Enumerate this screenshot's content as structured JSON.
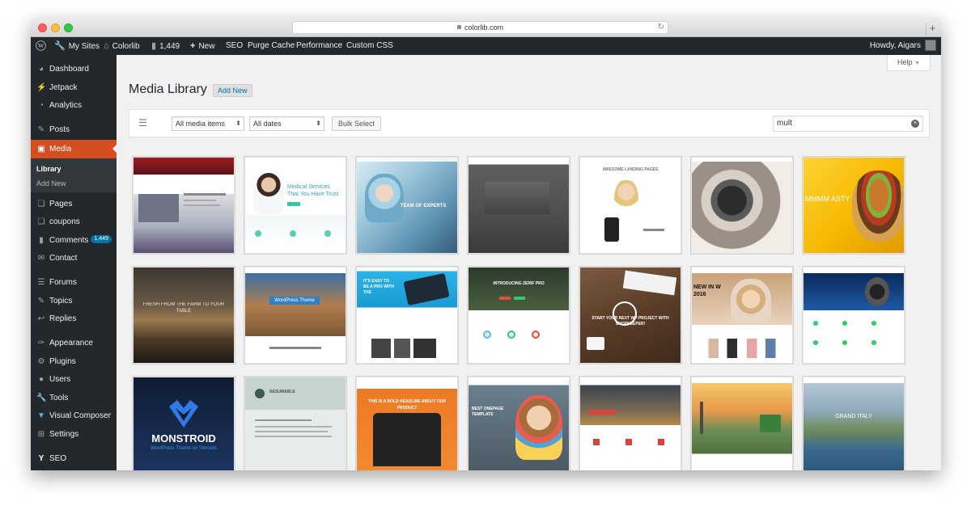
{
  "browser": {
    "url": "colorlib.com"
  },
  "adminbar": {
    "my_sites": "My Sites",
    "site_name": "Colorlib",
    "comments_count": "1,449",
    "new_label": "New",
    "seo": "SEO",
    "purge_cache": "Purge Cache",
    "performance": "Performance",
    "custom_css": "Custom CSS",
    "howdy": "Howdy, Aigars"
  },
  "sidebar": {
    "dashboard": "Dashboard",
    "jetpack": "Jetpack",
    "analytics": "Analytics",
    "posts": "Posts",
    "media": "Media",
    "library": "Library",
    "add_new": "Add New",
    "pages": "Pages",
    "coupons": "coupons",
    "comments": "Comments",
    "comments_badge": "1,449",
    "contact": "Contact",
    "forums": "Forums",
    "topics": "Topics",
    "replies": "Replies",
    "appearance": "Appearance",
    "plugins": "Plugins",
    "users": "Users",
    "tools": "Tools",
    "visual_composer": "Visual Composer",
    "settings": "Settings",
    "seo": "SEO"
  },
  "main": {
    "help": "Help",
    "title": "Media Library",
    "add_new": "Add New",
    "filter_type": "All media items",
    "filter_date": "All dates",
    "bulk_select": "Bulk Select",
    "search_value": "mult"
  },
  "tiles": [
    {
      "caption": ""
    },
    {
      "caption": "Medical Services That You Have Trust"
    },
    {
      "caption": "TEAM OF EXPERTS"
    },
    {
      "caption": ""
    },
    {
      "caption": "AWESOME LANDING PAGES"
    },
    {
      "caption": ""
    },
    {
      "caption": "MMMM ASTY"
    },
    {
      "caption": "FRESH FROM THE FARM TO YOUR TABLE"
    },
    {
      "caption": "WordPress Theme"
    },
    {
      "caption": "IT'S EASY TO BE A PRO WITH THE"
    },
    {
      "caption": "INTRODUCING ZERIF PRO"
    },
    {
      "caption": "START YOUR NEXT WP PROJECT WITH SHOPKEEPER!"
    },
    {
      "caption": "NEW IN W 2016"
    },
    {
      "caption": ""
    },
    {
      "caption": "MONSTROID",
      "sub": "WordPress Theme on Steroids"
    },
    {
      "caption": "RESUMABLE"
    },
    {
      "caption": "THIS IS A BOLD HEADLINE ABOUT OUR PRODUCT"
    },
    {
      "caption": "BEST ONEPAGE TEMPLATE"
    },
    {
      "caption": ""
    },
    {
      "caption": ""
    },
    {
      "caption": "GRAND ITALY"
    }
  ]
}
